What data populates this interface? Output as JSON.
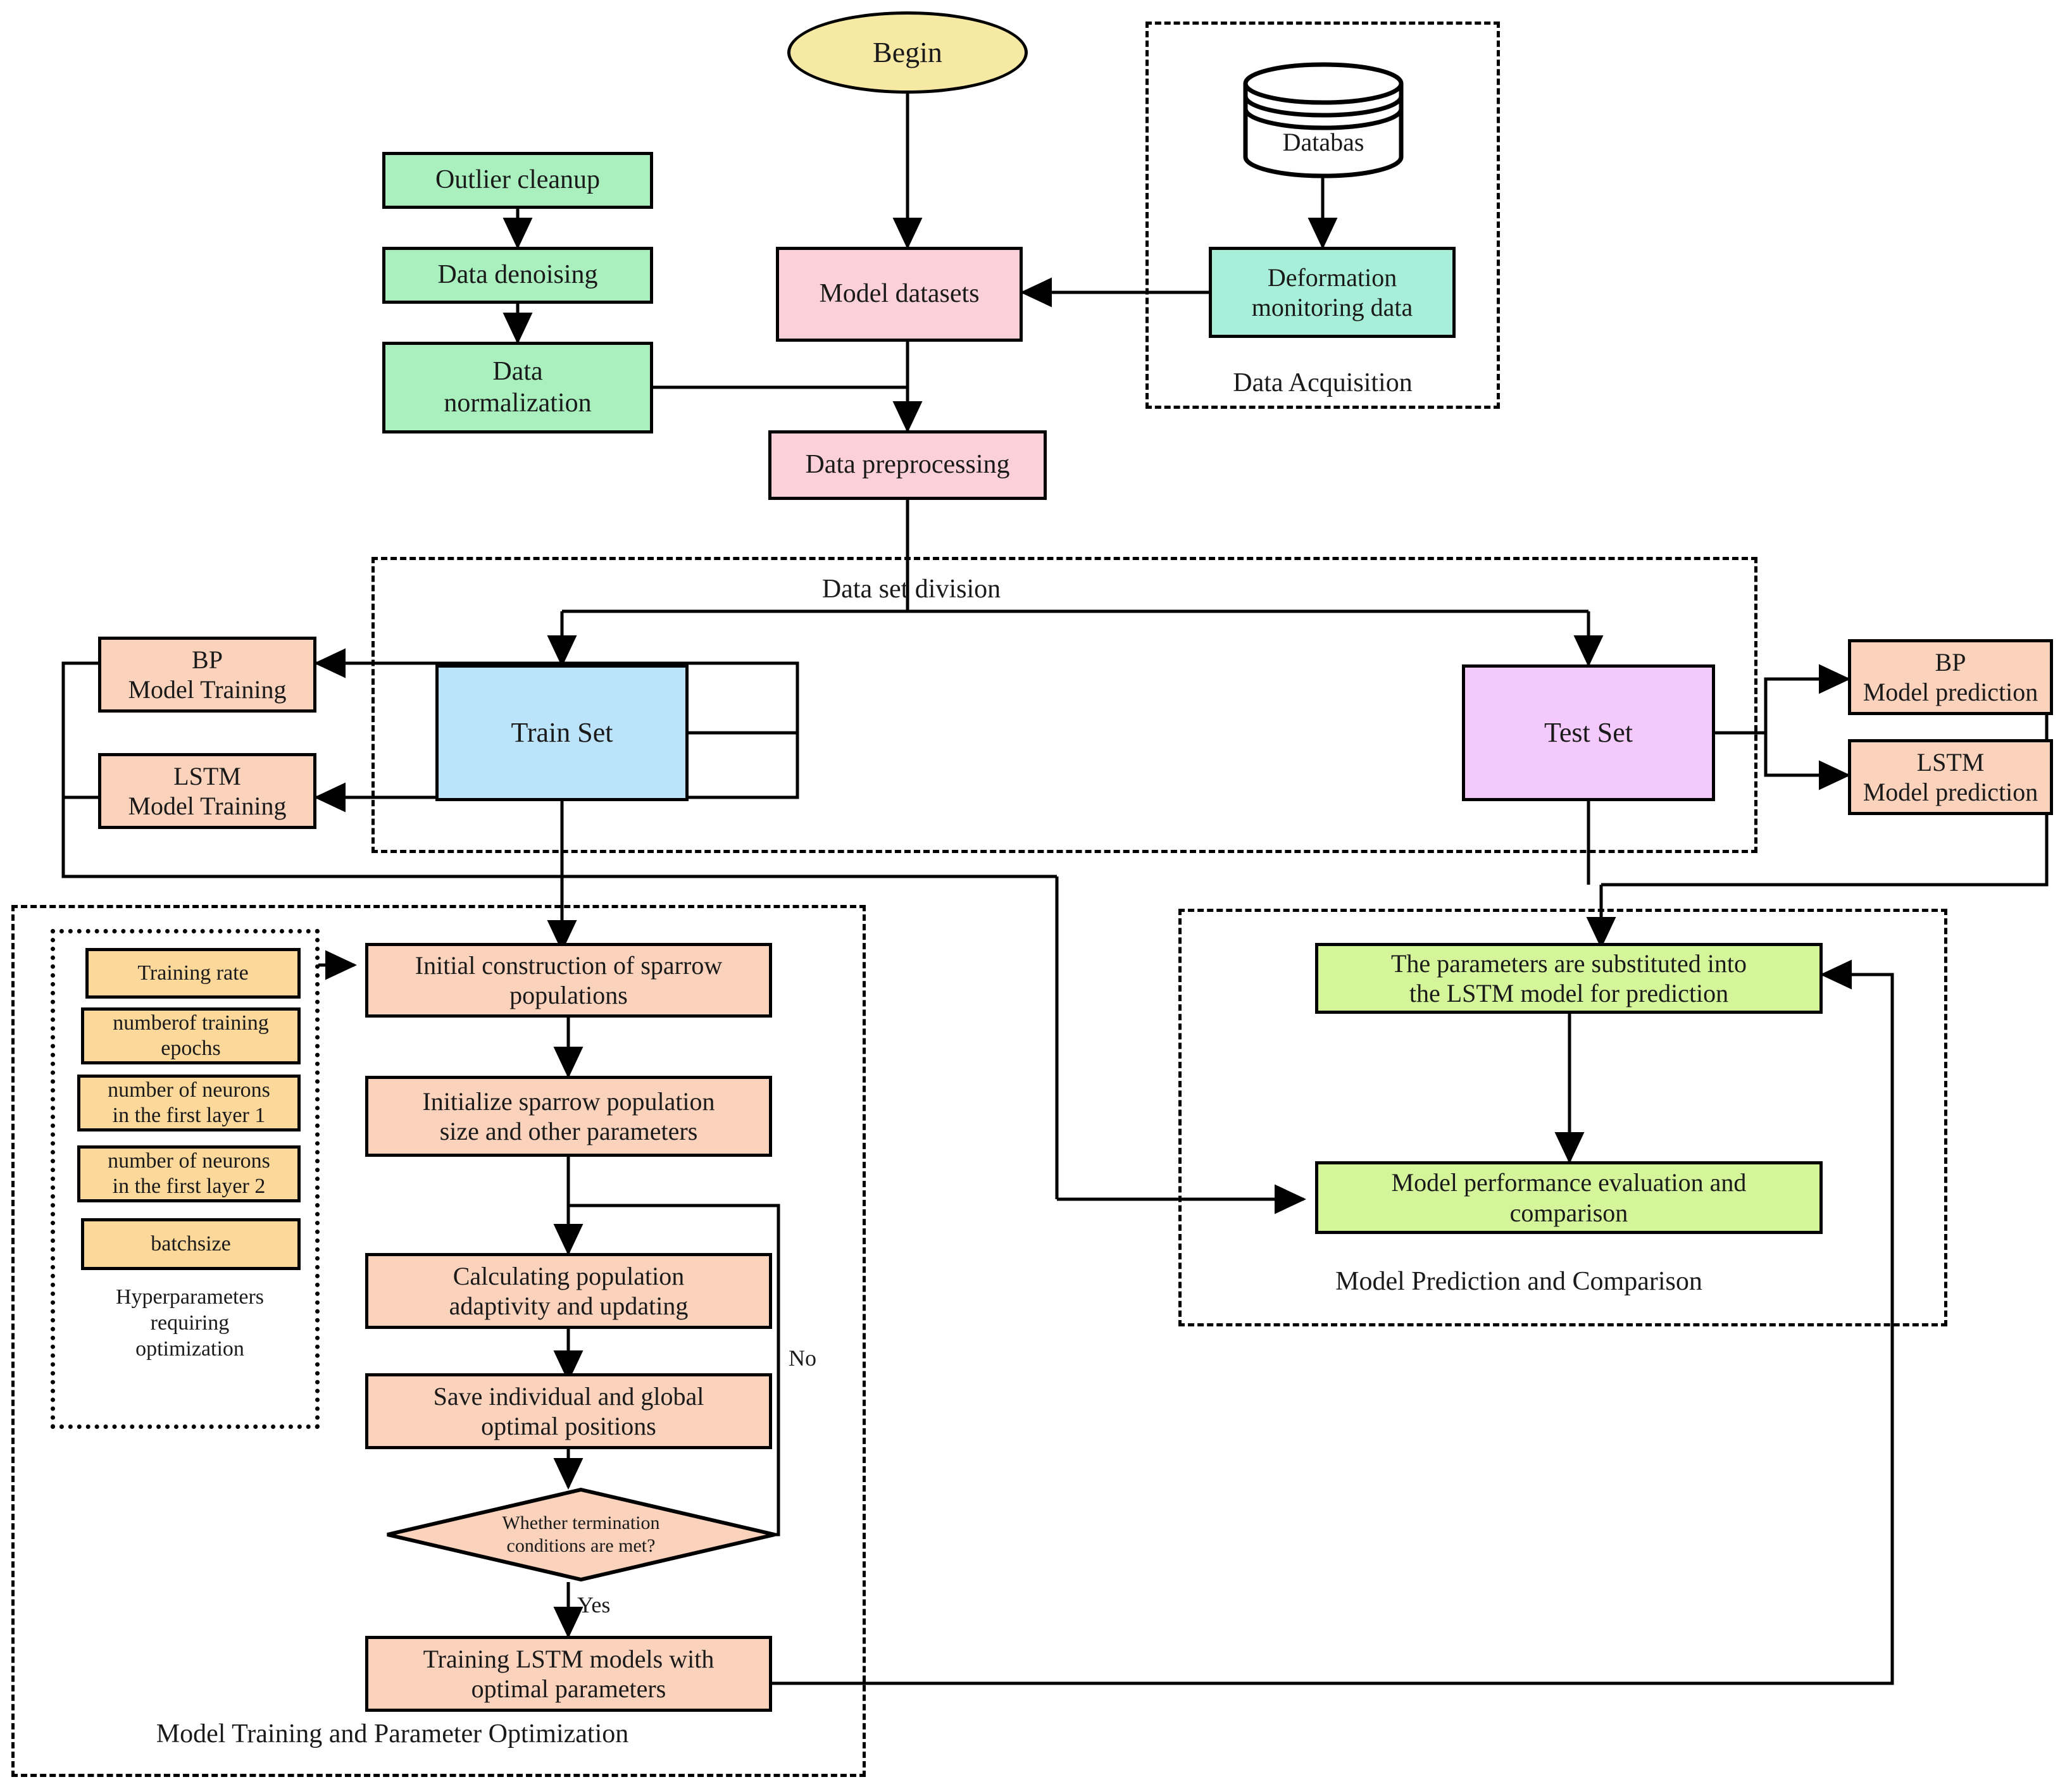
{
  "diagram": {
    "title": "Deformation prediction modeling workflow",
    "colors": {
      "green": "#aaf0bf",
      "pink": "#fcd0d8",
      "teal": "#a8efd9",
      "yellow": "#f5e9a3",
      "blue": "#bbe3fa",
      "purple": "#f4c9fb",
      "peach": "#fbd2bb",
      "orange": "#fcd89a",
      "lime": "#d4f59a",
      "stroke": "#000000"
    }
  },
  "nodes": {
    "begin": "Begin",
    "outlier_cleanup": "Outlier cleanup",
    "data_denoising": "Data denoising",
    "data_normalization": "Data\nnormalization",
    "model_datasets": "Model datasets",
    "data_preprocessing": "Data preprocessing",
    "database": "Databas",
    "deformation_monitoring": "Deformation\nmonitoring data",
    "train_set": "Train Set",
    "test_set": "Test Set",
    "bp_model_training": "BP\nModel Training",
    "lstm_model_training": "LSTM\nModel Training",
    "bp_model_prediction": "BP\nModel prediction",
    "lstm_model_prediction": "LSTM\nModel prediction",
    "initial_construction": "Initial construction of sparrow\npopulations",
    "initialize_population": "Initialize sparrow population\nsize and other parameters",
    "calculating_adaptivity": "Calculating population\nadaptivity and updating",
    "save_positions": "Save individual and global\noptimal positions",
    "termination_decision": "Whether termination\nconditions are met?",
    "training_lstm_optimal": "Training LSTM models with\noptimal parameters",
    "parameters_substituted": "The parameters are substituted into\nthe LSTM model for prediction",
    "performance_evaluation": "Model performance evaluation and\ncomparison"
  },
  "hyperparameters": {
    "items": [
      "Training rate",
      "numberof training\nepochs",
      "number of neurons\nin the first layer 1",
      "number of neurons\nin the first layer 2",
      "batchsize"
    ],
    "caption": "Hyperparameters\nrequiring\noptimization"
  },
  "groups": {
    "data_acquisition": "Data Acquisition",
    "data_set_division": "Data set division",
    "model_training_optimization": "Model Training and Parameter Optimization",
    "model_prediction_comparison": "Model Prediction and Comparison"
  },
  "edge_labels": {
    "no": "No",
    "yes": "Yes"
  }
}
